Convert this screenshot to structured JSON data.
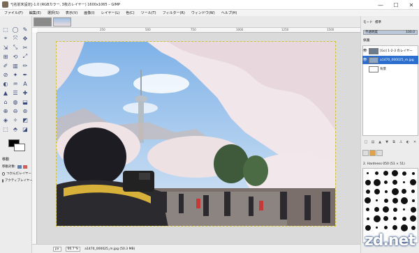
{
  "window": {
    "title": "*[名前未設定]-1.0 (RGBカラー, 3枚のレイヤー) 1600x1065 – GIMP",
    "min": "—",
    "max": "☐",
    "close": "✕"
  },
  "menu": [
    "ファイル(F)",
    "編集(E)",
    "選択(S)",
    "表示(V)",
    "画像(I)",
    "レイヤー(L)",
    "色(C)",
    "ツール(T)",
    "フィルター(R)",
    "ウィンドウ(W)",
    "ヘルプ(H)"
  ],
  "toolbox": {
    "tools": [
      "⬚",
      "◯",
      "✎",
      "⌖",
      "⤧",
      "✥",
      "⇲",
      "⤡",
      "✂",
      "⊞",
      "⟲",
      "⤢",
      "✐",
      "▥",
      "✏",
      "⊘",
      "✦",
      "✒",
      "◐",
      "♒",
      "A",
      "▲",
      "☰",
      "✚",
      "⌂",
      "◍",
      "⬓",
      "⊕",
      "⊖",
      "⊛",
      "◈",
      "✧",
      "◩",
      "⬚",
      "⬘",
      "◪",
      "◫",
      "◧",
      "◨",
      "⬗",
      "◇",
      "◆",
      "◉",
      "⚲",
      "⟳",
      "✎",
      "⟡",
      "◭"
    ],
    "fg": "#000000",
    "bg": "#ffffff",
    "options_title": "移動",
    "option_mode": "移動対象:",
    "radio1": "つかんだレイヤー",
    "radio2": "アクティブレイヤー"
  },
  "status": {
    "unit": "px",
    "zoom": "66.7 %",
    "file": "a1470_000025_m.jpg (50.3 MB)"
  },
  "rulers": {
    "top": [
      "250",
      "500",
      "750",
      "1000",
      "1250",
      "1500"
    ]
  },
  "layers_panel": {
    "mode_label": "モード",
    "mode_value": "標準",
    "opacity_label": "不透明度",
    "opacity_value": "100.0",
    "lock_label": "保護:",
    "layers": [
      {
        "name": "[Go] 1-2-3 のレイヤー",
        "thumb_color": "#6b7a8c",
        "eye": "👁",
        "selected": false
      },
      {
        "name": "a1470_000025_m.jpg",
        "thumb_color": "#8fa7c4",
        "eye": "👁",
        "selected": true
      },
      {
        "name": "背景",
        "thumb_color": "#ffffff",
        "eye": "",
        "selected": false
      }
    ],
    "brush_label": "2. Hardness 050 (51 × 51)"
  },
  "watermark": "zd.net",
  "colors": {
    "accent": "#2d6fcf",
    "sky": "#a9c9ec",
    "blossom": "#f3e7e9"
  }
}
